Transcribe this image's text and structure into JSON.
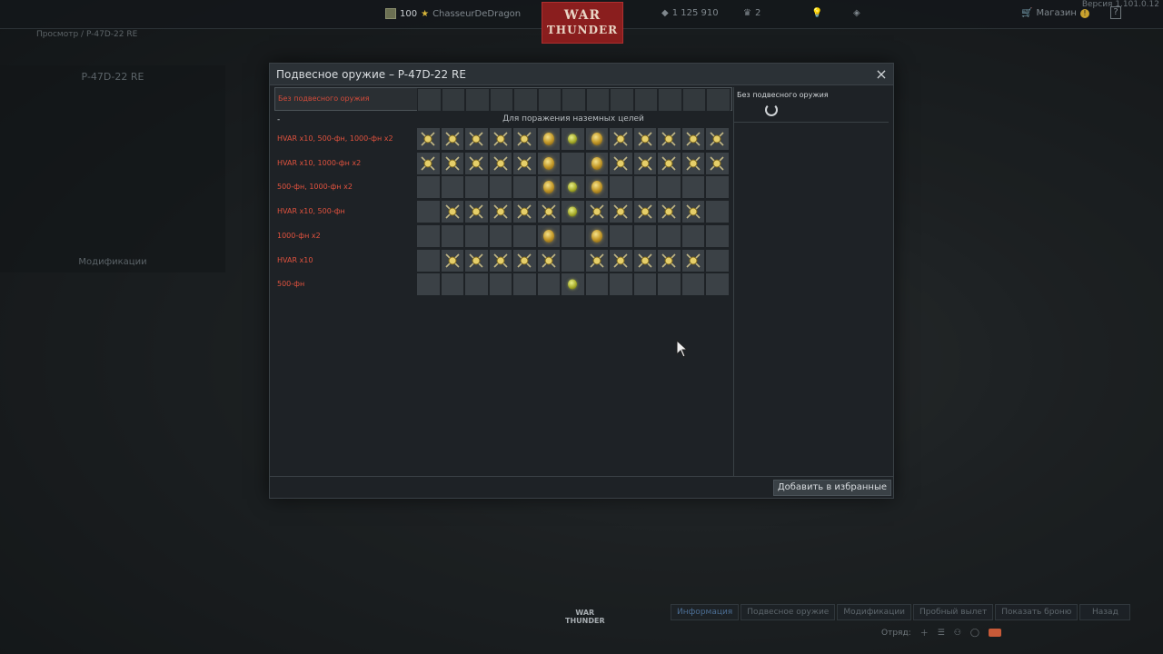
{
  "topbar": {
    "rank": "100",
    "username": "ChasseurDeDragon",
    "silver_lions": "1 125 910",
    "golden_eagles": "2",
    "shop_label": "Магазин",
    "help_label": "?",
    "version": "Версия 1.101.0.12",
    "logo_line1": "WAR",
    "logo_line2": "THUNDER"
  },
  "breadcrumb": "Просмотр / P-47D-22 RE",
  "left_panel": {
    "title": "P-47D-22 RE",
    "modifications": "Модификации"
  },
  "modal": {
    "title": "Подвесное оружие – P-47D-22 RE",
    "close_icon": "×",
    "no_weapon_label": "Без подвесного оружия",
    "category_dash": "-",
    "category_title": "Для поражения наземных целей",
    "rows": [
      {
        "label": "HVAR x10,  500-фн,  1000-фн x2",
        "slots": [
          "rocket",
          "rocket",
          "rocket",
          "rocket",
          "rocket",
          "bomb-big",
          "bomb-small",
          "bomb-big",
          "rocket",
          "rocket",
          "rocket",
          "rocket",
          "rocket"
        ]
      },
      {
        "label": "HVAR x10,  1000-фн x2",
        "slots": [
          "rocket",
          "rocket",
          "rocket",
          "rocket",
          "rocket",
          "bomb-big",
          "empty",
          "bomb-big",
          "rocket",
          "rocket",
          "rocket",
          "rocket",
          "rocket"
        ]
      },
      {
        "label": "500-фн,  1000-фн x2",
        "slots": [
          "empty",
          "empty",
          "empty",
          "empty",
          "empty",
          "bomb-big",
          "bomb-small",
          "bomb-big",
          "empty",
          "empty",
          "empty",
          "empty",
          "empty"
        ]
      },
      {
        "label": "HVAR x10,  500-фн",
        "slots": [
          "empty",
          "rocket",
          "rocket",
          "rocket",
          "rocket",
          "rocket",
          "bomb-small",
          "rocket",
          "rocket",
          "rocket",
          "rocket",
          "rocket",
          "empty"
        ]
      },
      {
        "label": "1000-фн x2",
        "slots": [
          "empty",
          "empty",
          "empty",
          "empty",
          "empty",
          "bomb-big",
          "empty",
          "bomb-big",
          "empty",
          "empty",
          "empty",
          "empty",
          "empty"
        ]
      },
      {
        "label": "HVAR x10",
        "slots": [
          "empty",
          "rocket",
          "rocket",
          "rocket",
          "rocket",
          "rocket",
          "empty",
          "rocket",
          "rocket",
          "rocket",
          "rocket",
          "rocket",
          "empty"
        ]
      },
      {
        "label": "500-фн",
        "slots": [
          "empty",
          "empty",
          "empty",
          "empty",
          "empty",
          "empty",
          "bomb-small",
          "empty",
          "empty",
          "empty",
          "empty",
          "empty",
          "empty"
        ]
      }
    ],
    "side_title": "Без подвесного оружия",
    "favorite_button": "Добавить в избранные"
  },
  "bottom": {
    "logo_line1": "WAR",
    "logo_line2": "THUNDER",
    "tabs": [
      "Информация",
      "Подвесное оружие",
      "Модификации",
      "Пробный вылет",
      "Показать броню",
      "Назад"
    ],
    "squad_label": "Отряд:"
  }
}
